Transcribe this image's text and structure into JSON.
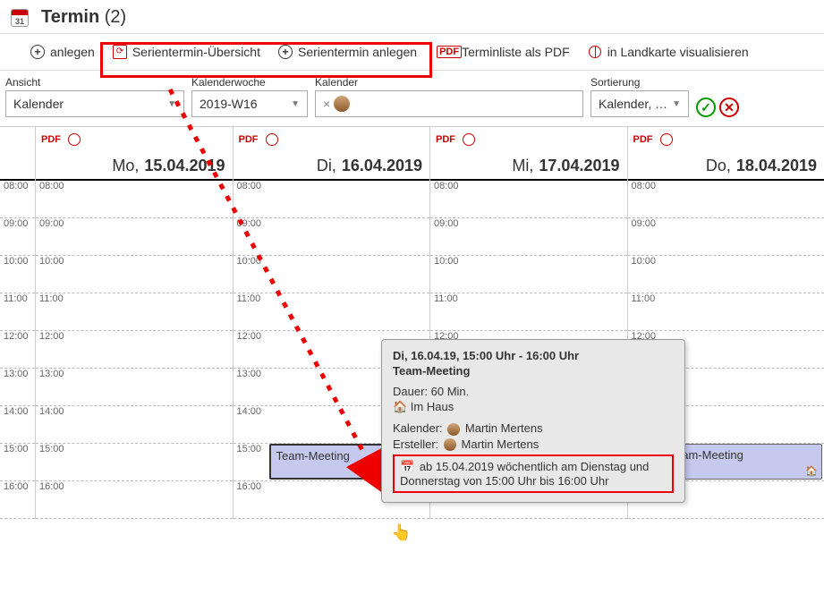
{
  "header": {
    "title_bold": "Termin",
    "title_count": "(2)"
  },
  "toolbar": {
    "anlegen": "anlegen",
    "serien_uebersicht": "Serientermin-Übersicht",
    "serien_anlegen": "Serientermin anlegen",
    "pdf": "Terminliste als PDF",
    "landkarte": "in Landkarte visualisieren"
  },
  "filters": {
    "ansicht_label": "Ansicht",
    "ansicht_value": "Kalender",
    "kw_label": "Kalenderwoche",
    "kw_value": "2019-W16",
    "kalender_label": "Kalender",
    "kalender_remove": "×",
    "sort_label": "Sortierung",
    "sort_value": "Kalender, …"
  },
  "days": [
    {
      "dow": "Mo,",
      "date": "15.04.2019"
    },
    {
      "dow": "Di,",
      "date": "16.04.2019"
    },
    {
      "dow": "Mi,",
      "date": "17.04.2019"
    },
    {
      "dow": "Do,",
      "date": "18.04.2019"
    }
  ],
  "hours": [
    "08:00",
    "09:00",
    "10:00",
    "11:00",
    "12:00",
    "13:00",
    "14:00",
    "15:00",
    "16:00"
  ],
  "events": {
    "tuesday": {
      "title": "Team-Meeting"
    },
    "thursday": {
      "title": "Team-Meeting"
    }
  },
  "tooltip": {
    "head": "Di, 16.04.19, 15:00 Uhr - 16:00 Uhr",
    "title": "Team-Meeting",
    "dauer": "Dauer: 60 Min.",
    "imhaus": "🏠 Im Haus",
    "kalender_label": "Kalender:",
    "kalender_name": "Martin Mertens",
    "ersteller_label": "Ersteller:",
    "ersteller_name": "Martin Mertens",
    "recur": "ab 15.04.2019 wöchentlich am Dienstag und Donnerstag von 15:00 Uhr bis 16:00 Uhr"
  }
}
